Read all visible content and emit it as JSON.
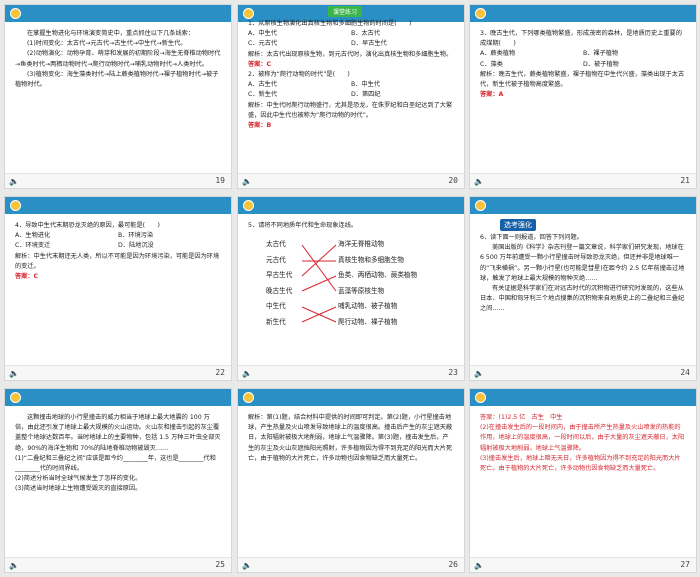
{
  "slides": [
    {
      "page": "19",
      "lines": [
        "在掌握生物进化与环境演变简史中，重点抓住以下几条线索：",
        "(1)时间变化：太古代→元古代→古生代→中生代→新生代。",
        "(2)动物演化：动物孕育、萌芽和发展的初期阶段→海生无脊椎动物时代→鱼类时代→两栖动物时代→爬行动物时代→哺乳动物时代→人类时代。",
        "(3)植物变化：海生藻类时代→陆上蕨类植物时代→裸子植物时代→被子植物时代。"
      ]
    },
    {
      "page": "20",
      "tag": "课堂练习",
      "q1": "1．从原核生物演化出真核生物和多细胞生物的时间是(　　)",
      "q1_opts": [
        "A．中生代",
        "B．太古代",
        "C．元古代",
        "D．早古生代"
      ],
      "q1_exp": "解析：太古代出现原核生物，到元古代时，演化出真核生物和多细胞生物。",
      "q1_ans": "答案：C",
      "q2": "2．被称为“爬行动物的时代”是(　　)",
      "q2_opts": [
        "A．古生代",
        "B．中生代",
        "C．新生代",
        "D．第四纪"
      ],
      "q2_exp": "解析：中生代时爬行动物盛行，尤其是恐龙，在侏罗纪和白垩纪达到了大繁盛，因此中生代也被称为“爬行动物的时代”。",
      "q2_ans": "答案：B"
    },
    {
      "page": "21",
      "q": "3．晚古生代，下列哪类植物繁盛，形成茂密的森林，是地质历史上重要的成煤期(　　)",
      "opts": [
        "A．蕨类植物",
        "B．裸子植物",
        "C．藻类",
        "D．被子植物"
      ],
      "exp": "解析：晚古生代，蕨类植物繁盛，裸子植物在中生代兴盛，藻类出现于太古代，新生代被子植物高度繁盛。",
      "ans": "答案：A"
    },
    {
      "page": "22",
      "q": "4．导致中生代末期恐龙灭绝的原因，最可能是(　　)",
      "opts": [
        "A．生物进化",
        "B．环境污染",
        "C．环境变迁",
        "D．陆地沉没"
      ],
      "exp": "解析：中生代末期还无人类，所以不可能是因为环境污染，可能是因为环境的变迁。",
      "ans": "答案：C"
    },
    {
      "page": "23",
      "q": "5．请将不同地质年代和生命现象连线。",
      "left": [
        "太古代",
        "元古代",
        "早古生代",
        "晚古生代",
        "中生代",
        "新生代"
      ],
      "right": [
        "海洋无脊椎动物",
        "真核生物和多细胞生物",
        "鱼类、两栖动物、蕨类植物",
        "蓝藻等原核生物",
        "哺乳动物、被子植物",
        "爬行动物、裸子植物"
      ]
    },
    {
      "page": "24",
      "tag": "选考强化",
      "lines": [
        "6．读下面一则报道，回答下列问题。",
        "美国出版的《科学》杂志刊登一篇文章说，科学家们研究发现，地球在 6 500 万年前遭受一颗小行星撞击时导致恐龙灭绝，但还并非是地球唯一的“飞来横祸”。另一颗小行星(也可能是彗星)在距今约 2.5 亿年前撞击过地球，触发了地球上最大规模的物种灭绝……",
        "有关证据是科学家们在对远古时代的沉积物进行研究时发现的，这些从日本、中国和匈牙利三个地点搜集的沉积物来自地质史上的二叠纪和三叠纪之间……"
      ]
    },
    {
      "page": "25",
      "lines": [
        "这颗撞击地球的小行星撞击的威力相当于地球上最大地震的 100 万倍，由此还引发了地球上最大规模的火山运动。火山灰和撞击引起的灰尘覆盖整个地球达数百年。当时地球上的主要物种，包括 1.5 万种三叶虫全部灭绝，90%的海洋生物和 70%的陆地脊椎动物被毁灭……",
        "(1)“二叠纪和三叠纪之间”应该是距今约________年，这也是________代和________代的时间界线。",
        "(2)简述分析当时全球气候发生了怎样的变化。",
        "(3)简述当时地球上生物遭受毁灭的直接原因。"
      ]
    },
    {
      "page": "26",
      "lines": [
        "解析：第(1)题，结合材料中提供的时间即可判定。第(2)题，小行星撞击地球，产生热量及火山喷发导致地球上的温度很高。撞击后产生的灰尘遮天蔽日，太阳辐射被极大地削弱，地球上气温骤降。第(3)题，撞击发生后，产生的灰尘及火山灰遮挡阳光照射，许多植物因为得不到充足的阳光而大片死亡，由于植物的大片死亡，许多动物也因食物缺乏而大量死亡。"
      ]
    },
    {
      "page": "27",
      "lines": [
        "答案：(1)2.5 亿　古生　中生",
        "(2)在撞击发生后的一段时间内，由于撞击所产生热量及火山喷发的热能的作用，地球上的温度很高，一段时间以后，由于大量的灰尘遮天蔽日，太阳辐射被极大地削弱，地球上气温骤降。",
        "(3)撞击发生后，地球上暗无天日，许多植物因为得不到充足的阳光而大片死亡。由于植物的大片死亡，许多动物也因食物缺乏而大量死亡。"
      ]
    }
  ]
}
